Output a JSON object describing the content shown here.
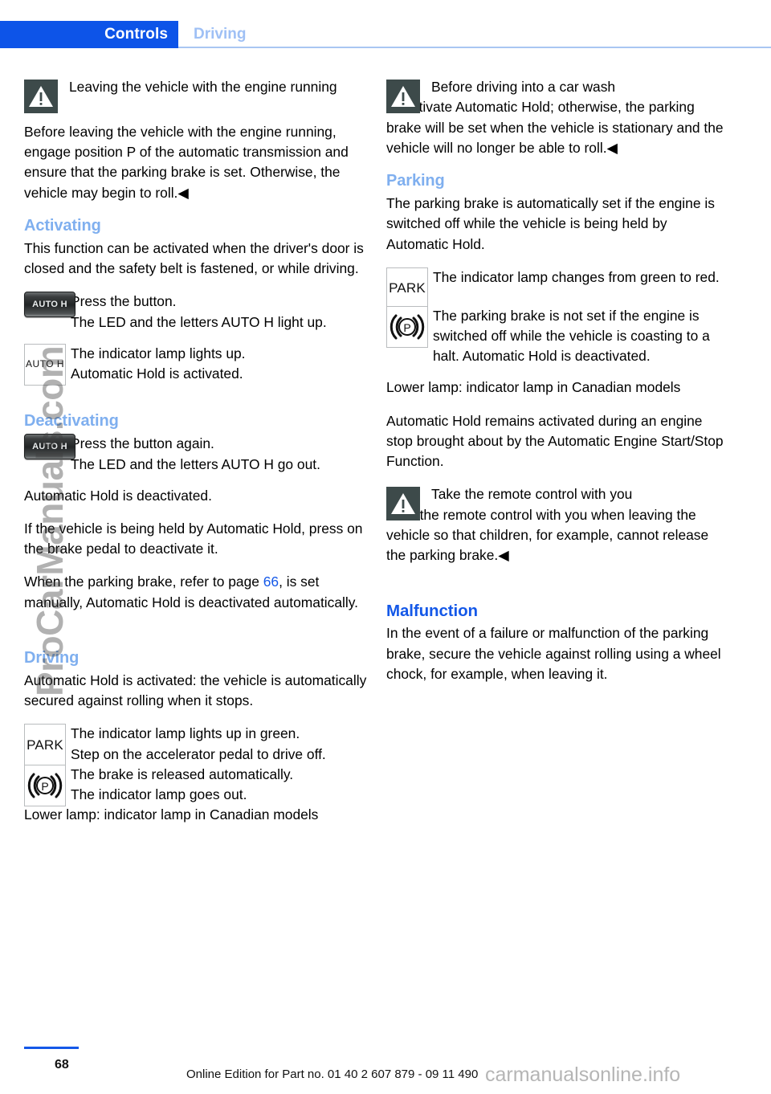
{
  "header": {
    "active_tab": "Controls",
    "inactive_tab": "Driving",
    "accent_active_bg": "#0d54e8",
    "accent_inactive_text": "#9fc0f5",
    "rule_color": "#a9c6f2"
  },
  "left_column": {
    "warning_engine_running": {
      "icon": "warning-triangle-icon",
      "title": "Leaving the vehicle with the engine running",
      "body": "Before leaving the vehicle with the engine running, engage position P of the automatic transmission and ensure that the parking brake is set. Otherwise, the vehicle may begin to roll.◀"
    },
    "activating": {
      "heading": "Activating",
      "intro": "This function can be activated when the driver's door is closed and the safety belt is fastened, or while driving.",
      "step_button": {
        "symbol_label": "AUTO H",
        "symbol_name": "auto-h-button-symbol",
        "line1": "Press the button.",
        "line2": "The LED and the letters AUTO H light up."
      },
      "step_lamp": {
        "symbol_label": "AUTO H",
        "symbol_name": "auto-h-indicator-lamp-symbol",
        "line1": "The indicator lamp lights up.",
        "line2": "Automatic Hold is activated."
      }
    },
    "deactivating": {
      "heading": "Deactivating",
      "step_button": {
        "symbol_label": "AUTO H",
        "symbol_name": "auto-h-button-symbol",
        "line1": "Press the button again.",
        "line2": "The LED and the letters AUTO H go out."
      },
      "para1": "Automatic Hold is deactivated.",
      "para2": "If the vehicle is being held by Automatic Hold, press on the brake pedal to deactivate it.",
      "para3_before": "When the parking brake, refer to page ",
      "para3_link": "66",
      "para3_after": ", is set manually, Automatic Hold is deactivated automatically."
    },
    "driving": {
      "heading": "Driving",
      "intro": "Automatic Hold is activated: the vehicle is automatically secured against rolling when it stops.",
      "step_park": {
        "symbol_label": "PARK",
        "symbol_name": "park-indicator-lamp-symbol",
        "line1": "The indicator lamp lights up in green.",
        "line2": "Step on the accelerator pedal to drive off."
      },
      "step_brake": {
        "symbol_name": "parking-brake-p-lamp-symbol",
        "line1": "The brake is released automatically.",
        "line2": "The indicator lamp goes out."
      },
      "note": "Lower lamp: indicator lamp in Canadian models"
    }
  },
  "right_column": {
    "warning_car_wash": {
      "icon": "warning-triangle-icon",
      "title": "Before driving into a car wash",
      "body": "Deactivate Automatic Hold; otherwise, the parking brake will be set when the vehicle is stationary and the vehicle will no longer be able to roll.◀"
    },
    "parking": {
      "heading": "Parking",
      "intro": "The parking brake is automatically set if the engine is switched off while the vehicle is being held by Automatic Hold.",
      "step_park": {
        "symbol_label": "PARK",
        "symbol_name": "park-indicator-lamp-symbol",
        "line1": "The indicator lamp changes from green to red."
      },
      "step_brake": {
        "symbol_name": "parking-brake-p-lamp-symbol",
        "line1": "The parking brake is not set if the engine is switched off while the vehicle is coasting to a halt. Automatic Hold is deactivated."
      },
      "note": "Lower lamp: indicator lamp in Canadian models",
      "para_engine_stop": "Automatic Hold remains activated during an engine stop brought about by the Automatic Engine Start/Stop Function."
    },
    "warning_remote": {
      "icon": "warning-triangle-icon",
      "title": "Take the remote control with you",
      "body": "Take the remote control with you when leaving the vehicle so that children, for example, cannot release the parking brake.◀"
    },
    "malfunction": {
      "heading": "Malfunction",
      "body": "In the event of a failure or malfunction of the parking brake, secure the vehicle against rolling using a wheel chock, for example, when leaving it."
    }
  },
  "footer": {
    "page_number": "68",
    "edition": "Online Edition for Part no. 01 40 2 607 879 - 09 11 490"
  },
  "watermarks": {
    "vertical": "ProCarManuals.com",
    "footer": "carmanualsonline.info"
  }
}
